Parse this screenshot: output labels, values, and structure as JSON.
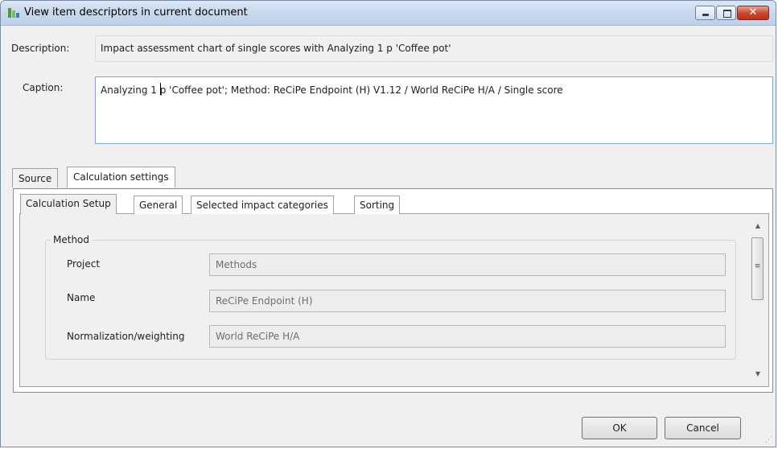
{
  "window": {
    "title": "View item descriptors in current document",
    "icon": "software-app-icon"
  },
  "fields": {
    "description_label": "Description:",
    "description_value": "Impact assessment chart of single scores with Analyzing 1 p 'Coffee pot'",
    "caption_label": "Caption:",
    "caption_value": "Analyzing 1 p 'Coffee pot'; Method: ReCiPe Endpoint (H) V1.12 / World ReCiPe H/A / Single score"
  },
  "outer_tabs": [
    {
      "label": "Source",
      "active": false
    },
    {
      "label": "Calculation settings",
      "active": true
    }
  ],
  "inner_tabs": [
    {
      "label": "Calculation Setup",
      "active": true
    },
    {
      "label": "General",
      "active": false
    },
    {
      "label": "Selected impact categories",
      "active": false
    },
    {
      "label": "Sorting",
      "active": false
    }
  ],
  "method": {
    "group_title": "Method",
    "rows": [
      {
        "label": "Project",
        "value": "Methods"
      },
      {
        "label": "Name",
        "value": "ReCiPe Endpoint (H)"
      },
      {
        "label": "Normalization/weighting",
        "value": "World ReCiPe H/A"
      }
    ]
  },
  "buttons": {
    "ok": "OK",
    "cancel": "Cancel"
  }
}
